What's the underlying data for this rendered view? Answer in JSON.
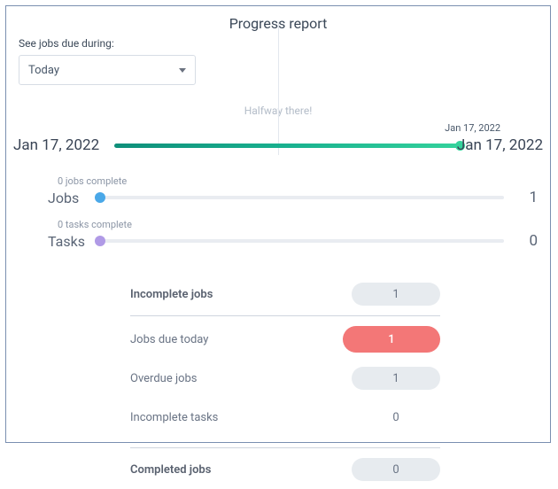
{
  "title": "Progress report",
  "filter": {
    "label": "See jobs due during:",
    "value": "Today"
  },
  "timeline": {
    "halfway_label": "Halfway there!",
    "start_date": "Jan 17, 2022",
    "end_date": "Jan 17, 2022",
    "top_date": "Jan 17, 2022"
  },
  "jobs": {
    "label": "Jobs",
    "sub": "0 jobs complete",
    "total": "1"
  },
  "tasks": {
    "label": "Tasks",
    "sub": "0 tasks complete",
    "total": "0"
  },
  "stats": {
    "incomplete_jobs": {
      "label": "Incomplete jobs",
      "value": "1"
    },
    "jobs_due_today": {
      "label": "Jobs due today",
      "value": "1"
    },
    "overdue_jobs": {
      "label": "Overdue jobs",
      "value": "1"
    },
    "incomplete_tasks": {
      "label": "Incomplete tasks",
      "value": "0"
    },
    "completed_jobs": {
      "label": "Completed jobs",
      "value": "0"
    }
  },
  "chart_data": {
    "type": "bar",
    "title": "Progress report",
    "series": [
      {
        "name": "Jobs",
        "completed": 0,
        "total": 1
      },
      {
        "name": "Tasks",
        "completed": 0,
        "total": 0
      }
    ],
    "timeline_progress_pct": 100,
    "period_start": "Jan 17, 2022",
    "period_end": "Jan 17, 2022"
  }
}
